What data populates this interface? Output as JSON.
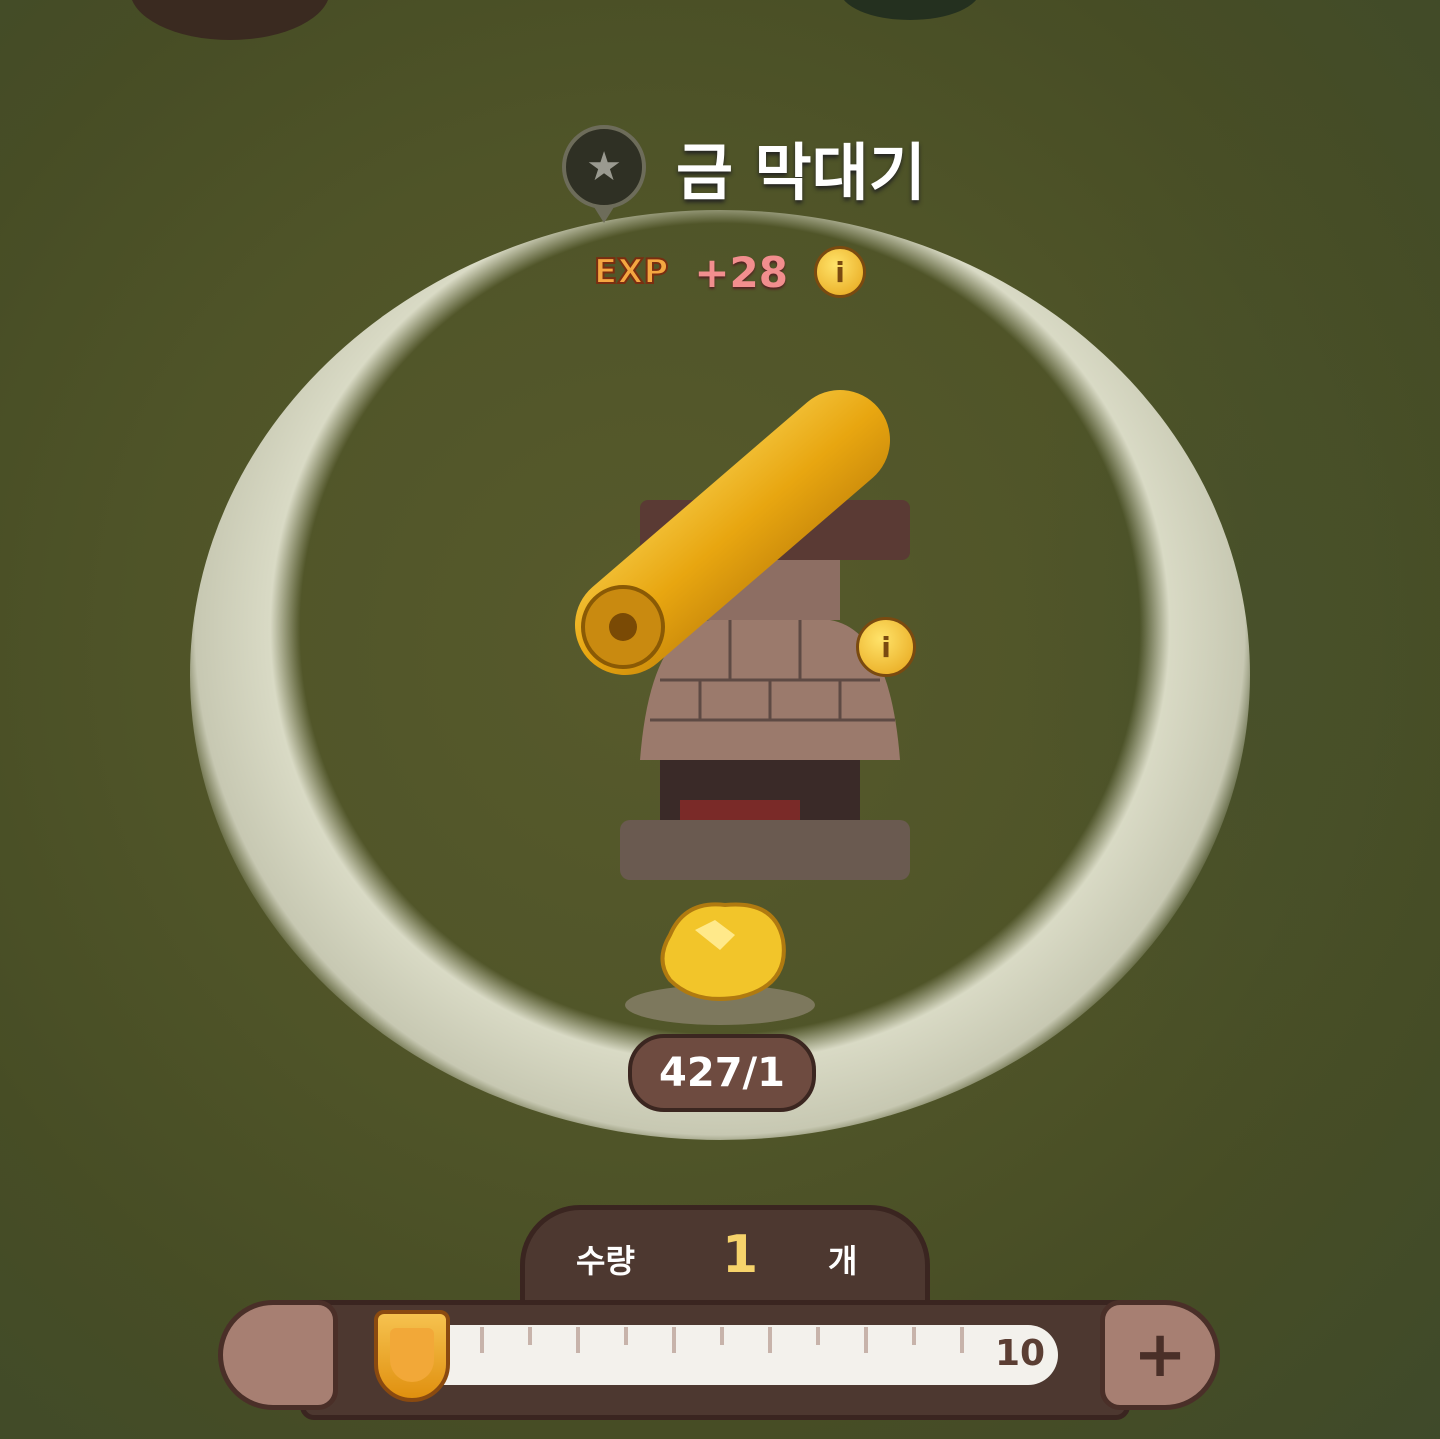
{
  "item": {
    "name": "금 막대기",
    "icon": "star-pin-icon"
  },
  "reward": {
    "label": "EXP",
    "value": "+28",
    "info_icon": "info-icon"
  },
  "material": {
    "count": "427/1",
    "icon": "gold-nugget-icon"
  },
  "quantity": {
    "label": "수량",
    "value": "1",
    "unit": "개",
    "max_label": "10",
    "min": 1,
    "max": 10,
    "fraction": 0
  },
  "colors": {
    "background": "#4f5428",
    "panel": "#4d3830",
    "accent": "#f6d36b",
    "exp_value": "#f28e8e"
  }
}
